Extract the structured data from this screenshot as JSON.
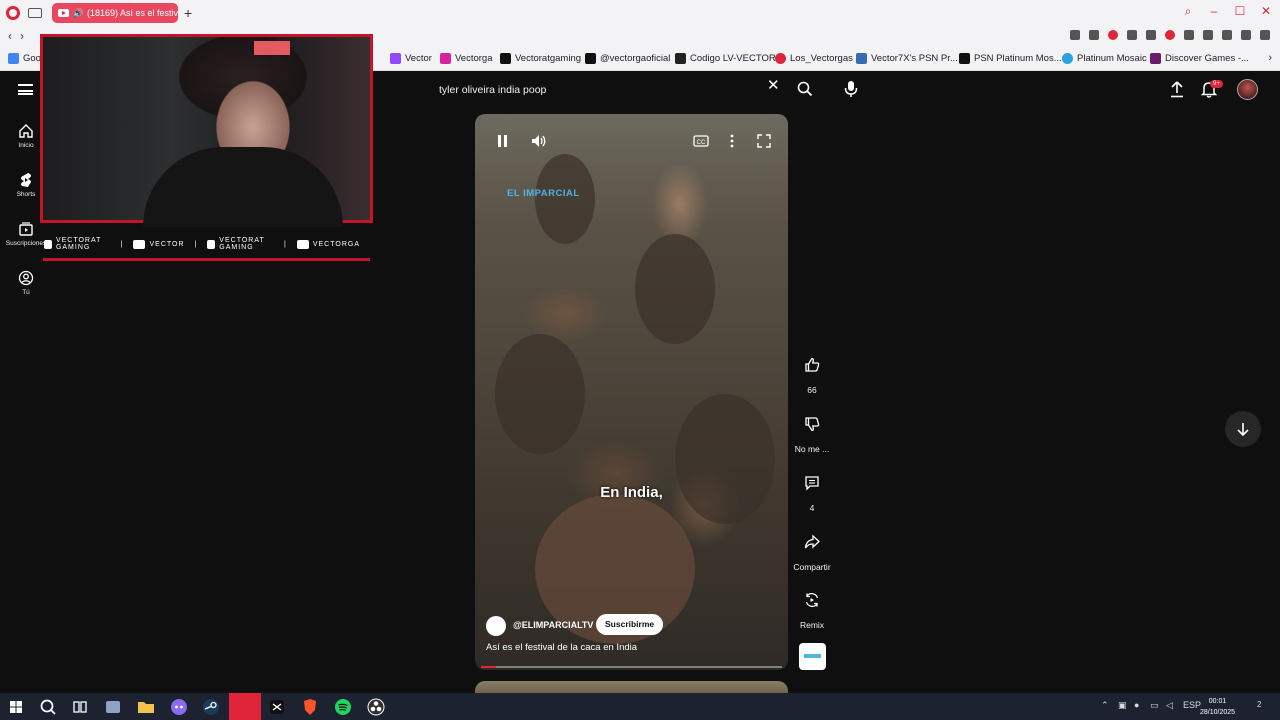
{
  "browser": {
    "tab_title": "(18169) Así es el festiv",
    "bookmarks": [
      {
        "label": "Goog",
        "color": "#4285f4"
      },
      {
        "label": "Vector",
        "color": "#9146ff"
      },
      {
        "label": "Vectorga",
        "color": "#d6249f"
      },
      {
        "label": "Vectoratgaming",
        "color": "#111111"
      },
      {
        "label": "@vectorgaoficial",
        "color": "#111111"
      },
      {
        "label": "Codigo LV-VECTOR",
        "color": "#222222"
      },
      {
        "label": "Los_Vectorgas",
        "color": "#e0243a"
      },
      {
        "label": "Vector7X's PSN Pr...",
        "color": "#3b6ab5"
      },
      {
        "label": "PSN Platinum Mos...",
        "color": "#111111"
      },
      {
        "label": "Platinum Mosaic",
        "color": "#2aa1e0"
      },
      {
        "label": "Discover Games -...",
        "color": "#6a1b6a"
      }
    ]
  },
  "sidebar": {
    "items": [
      {
        "label": "Inicio",
        "icon": "home-icon"
      },
      {
        "label": "Shorts",
        "icon": "shorts-icon"
      },
      {
        "label": "Suscripciones",
        "icon": "subscriptions-icon"
      },
      {
        "label": "Tú",
        "icon": "you-icon"
      }
    ]
  },
  "search": {
    "value": "tyler oliveira india poop"
  },
  "header": {
    "notifications_badge": "9+"
  },
  "overlay": {
    "socials": [
      "VECTORAT GAMING",
      "VECTOR",
      "VECTORAT GAMING",
      "VECTORGA"
    ]
  },
  "short": {
    "brand_watermark": "EL IMPARCIAL",
    "caption": "En India,",
    "channel": "@ELIMPARCIALTV",
    "subscribe_label": "Suscribirme",
    "title": "Así es el festival de la caca en India",
    "progress": 0.05
  },
  "actions": {
    "like_count": "66",
    "dislike_label": "No me ...",
    "comments_count": "4",
    "share_label": "Compartir",
    "remix_label": "Remix"
  },
  "taskbar": {
    "language": "ESP",
    "time": "00:01",
    "date": "28/10/2025",
    "notification_count": "2"
  },
  "colors": {
    "accent": "#e0243a",
    "yt_bg": "#0f0f0f",
    "overlay_red": "#c4142a"
  }
}
